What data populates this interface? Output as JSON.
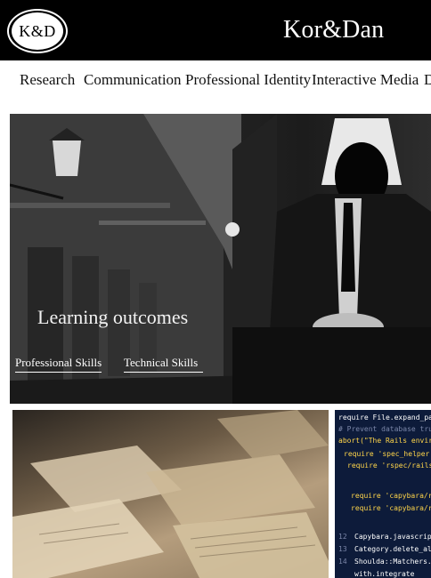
{
  "header": {
    "logo_text": "K&D",
    "brand": "Kor&Dan"
  },
  "nav": {
    "items": [
      {
        "label": "Research"
      },
      {
        "label": "Communication"
      },
      {
        "label": "Professional Identity"
      },
      {
        "label": "Interactive Media"
      },
      {
        "label": "D"
      }
    ]
  },
  "hero": {
    "title": "Learning outcomes",
    "links": [
      {
        "label": "Professional Skills"
      },
      {
        "label": "Technical Skills"
      }
    ]
  },
  "code_thumb": {
    "lines": [
      "require File.expand_path(\"",
      "# Prevent database truncat",
      "abort(\"The Rails environme",
      "require 'spec_helper'",
      "require 'rspec/rails'",
      "require 'capybara/rspec",
      "require 'capybara/rails",
      "Capybara.javascript_d",
      "Category.delete_all;",
      "Shoulda::Matchers.co",
      "with.integrate"
    ],
    "line_numbers": [
      "12",
      "13",
      "14"
    ]
  },
  "colors": {
    "header_bg": "#000000",
    "page_bg": "#ffffff"
  }
}
